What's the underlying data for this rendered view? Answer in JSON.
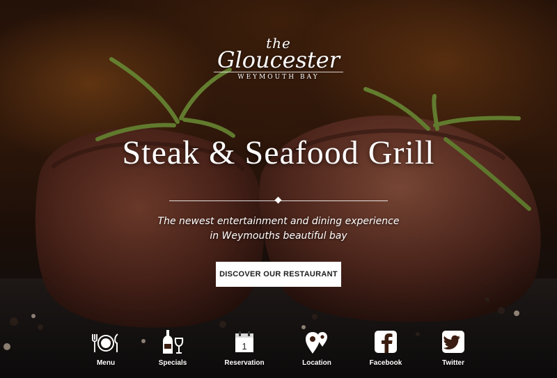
{
  "logo": {
    "the": "the",
    "name": "Gloucester",
    "subtitle": "WEYMOUTH BAY"
  },
  "hero": {
    "headline": "Steak & Seafood Grill",
    "tagline_line1": "The newest entertainment and dining experience",
    "tagline_line2": "in Weymouths beautiful bay",
    "cta_label": "DISCOVER OUR RESTAURANT"
  },
  "calendar_day": "1",
  "nav": {
    "items": [
      {
        "label": "Menu",
        "icon": "plate-cutlery-icon"
      },
      {
        "label": "Specials",
        "icon": "wine-icon"
      },
      {
        "label": "Reservation",
        "icon": "calendar-icon"
      },
      {
        "label": "Location",
        "icon": "map-pin-icon"
      },
      {
        "label": "Facebook",
        "icon": "facebook-icon"
      },
      {
        "label": "Twitter",
        "icon": "twitter-icon"
      }
    ]
  },
  "colors": {
    "text": "#ffffff",
    "button_bg": "#ffffff",
    "button_text": "#1c1c1c",
    "meat": "#6a3324",
    "herb": "#7a9a3a"
  }
}
